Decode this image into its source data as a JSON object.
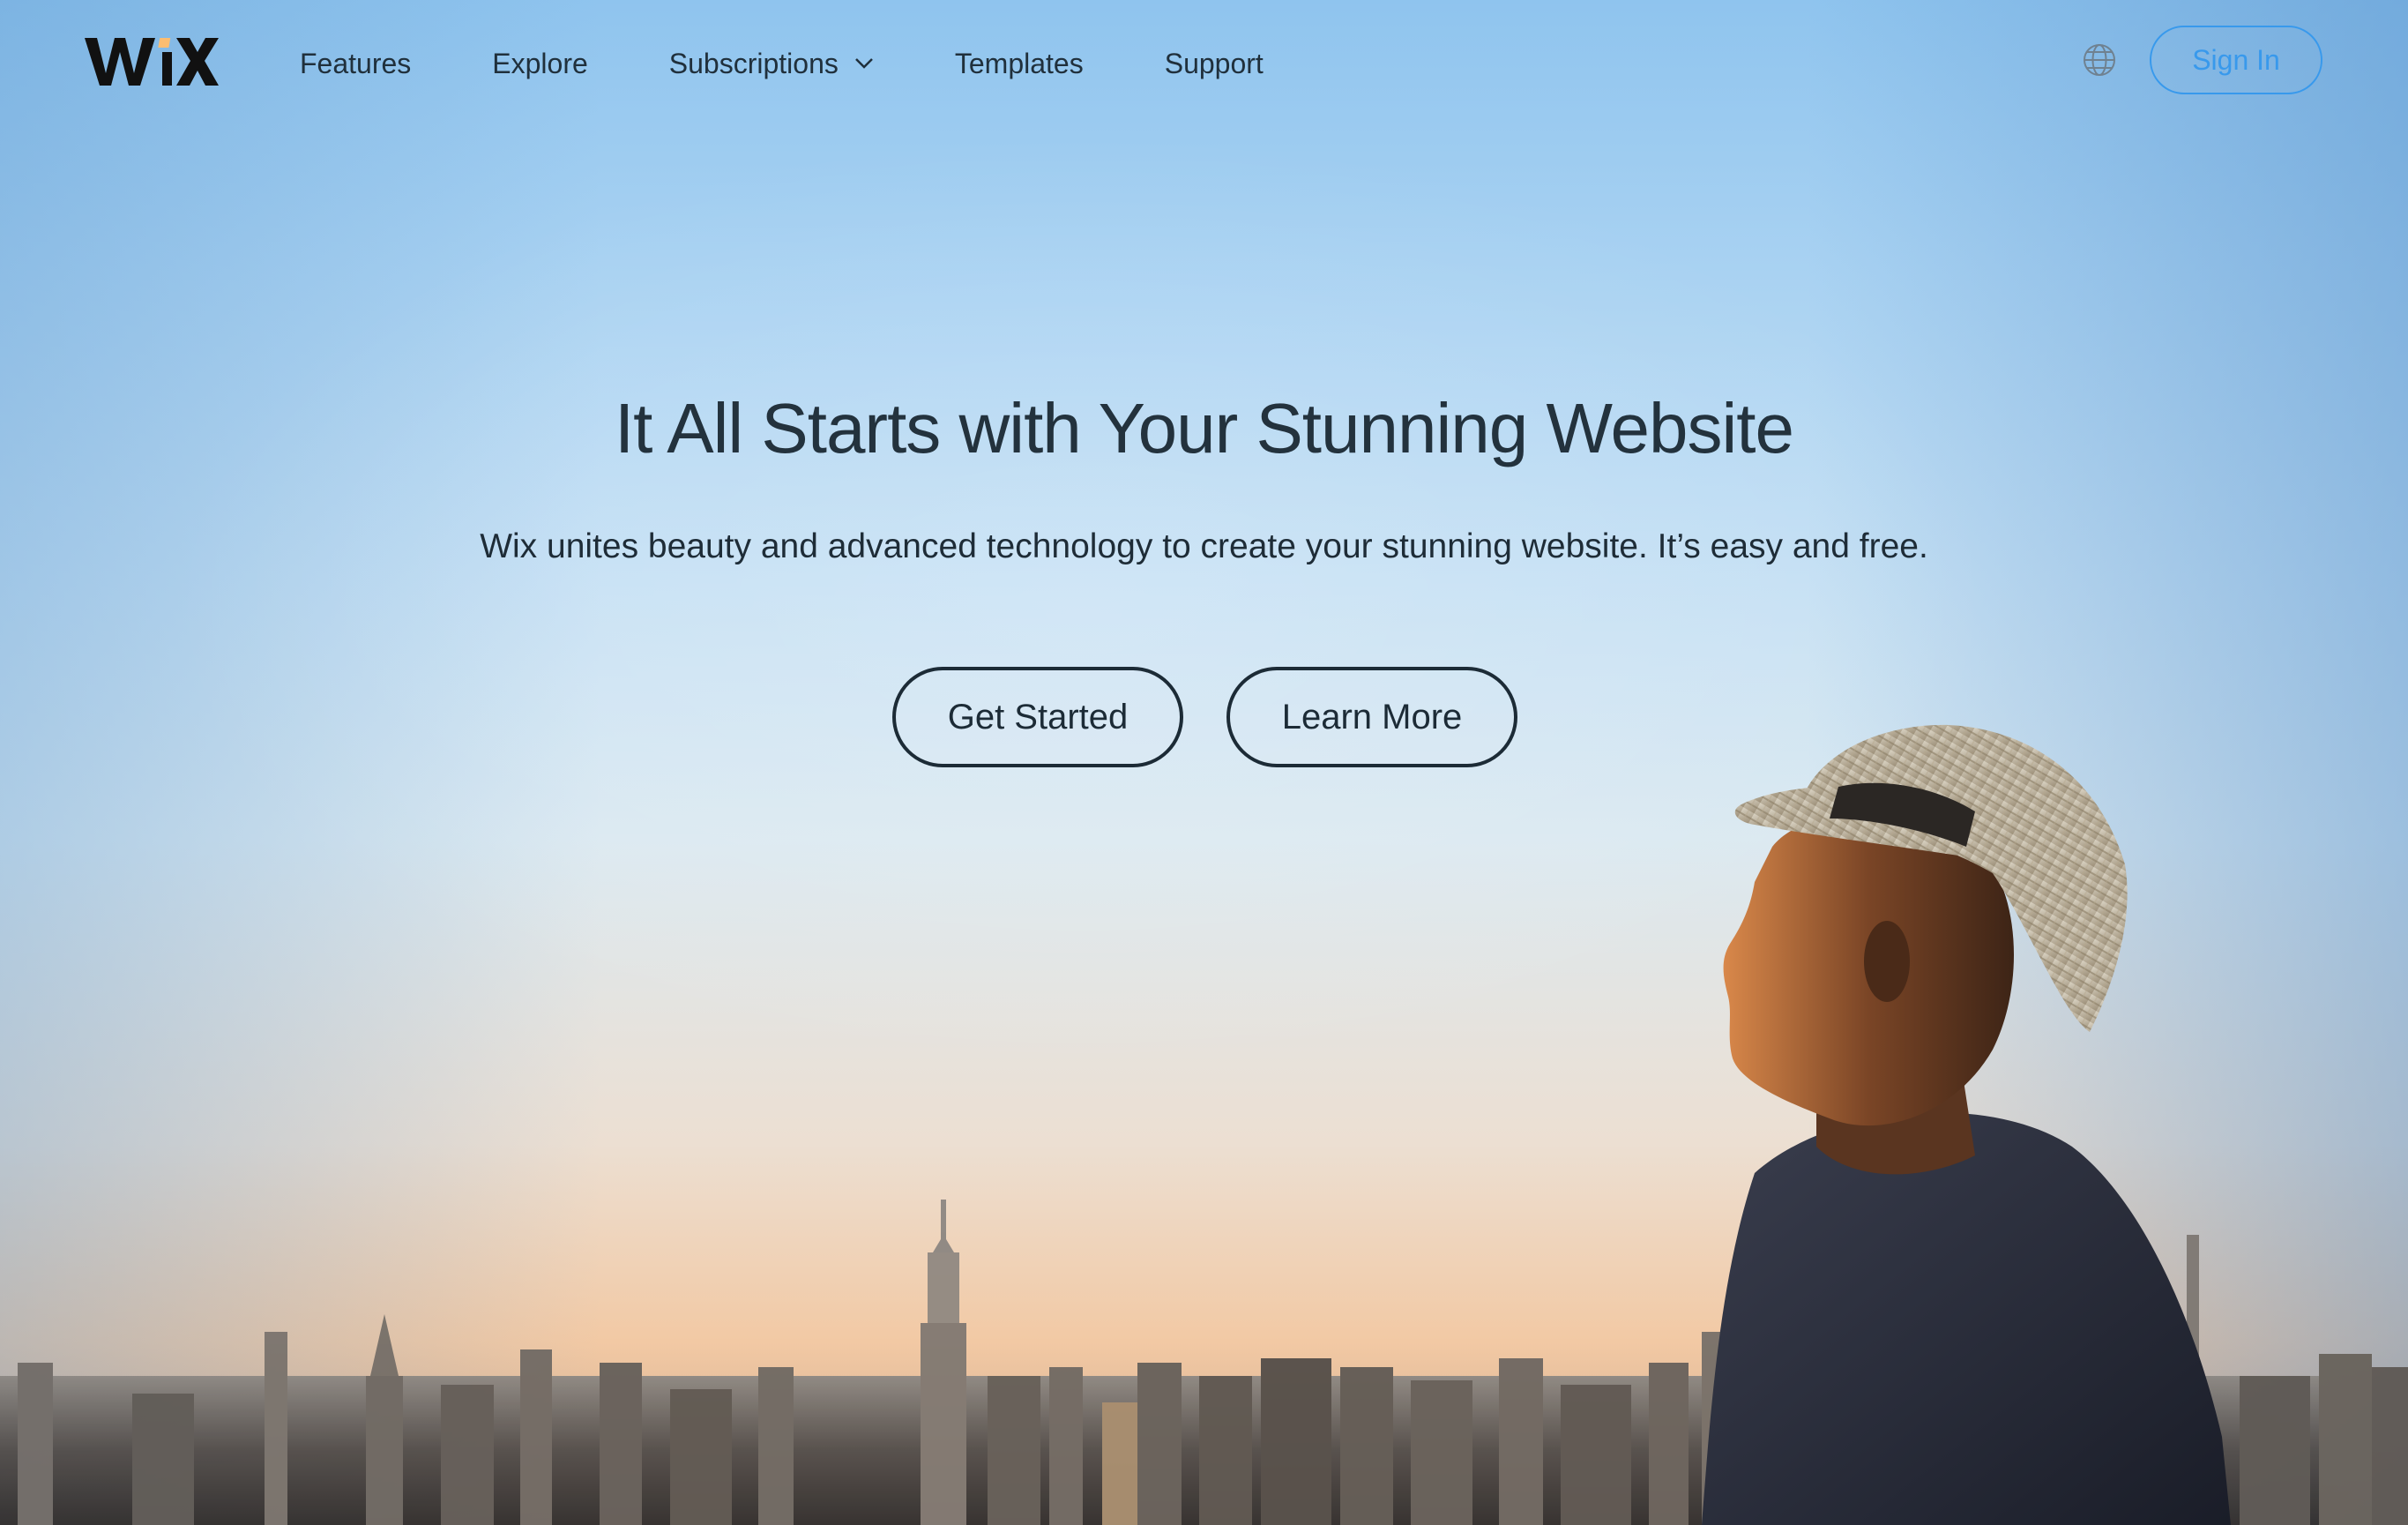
{
  "brand": {
    "logo_text": "WiX"
  },
  "nav": {
    "items": [
      {
        "label": "Features"
      },
      {
        "label": "Explore"
      },
      {
        "label": "Subscriptions",
        "has_dropdown": true
      },
      {
        "label": "Templates"
      },
      {
        "label": "Support"
      }
    ],
    "language_icon": "globe-icon",
    "signin_label": "Sign In"
  },
  "hero": {
    "title": "It All Starts with Your Stunning Website",
    "subtitle": "Wix unites beauty and advanced technology to create your stunning website. It’s easy and free.",
    "primary_button": "Get Started",
    "secondary_button": "Learn More"
  },
  "colors": {
    "accent": "#3899ec",
    "text_dark": "#1c2b36",
    "logo_dot": "#fbbd71"
  }
}
